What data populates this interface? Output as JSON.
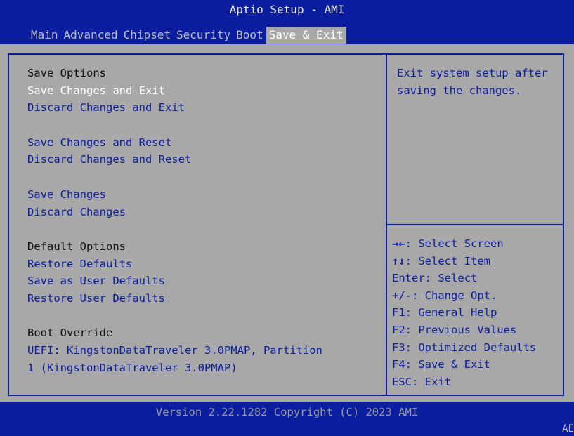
{
  "header": {
    "title": "Aptio Setup - AMI",
    "tabs": [
      "Main",
      "Advanced",
      "Chipset",
      "Security",
      "Boot",
      "Save & Exit"
    ],
    "active_tab": "Save & Exit"
  },
  "menu": {
    "save_options_header": "Save Options",
    "save_changes_and_exit": "Save Changes and Exit",
    "discard_changes_and_exit": "Discard Changes and Exit",
    "save_changes_and_reset": "Save Changes and Reset",
    "discard_changes_and_reset": "Discard Changes and Reset",
    "save_changes": "Save Changes",
    "discard_changes": "Discard Changes",
    "default_options_header": "Default Options",
    "restore_defaults": "Restore Defaults",
    "save_as_user_defaults": "Save as User Defaults",
    "restore_user_defaults": "Restore User Defaults",
    "boot_override_header": "Boot Override",
    "boot_override_line1": "UEFI: KingstonDataTraveler 3.0PMAP, Partition",
    "boot_override_line2": "1 (KingstonDataTraveler 3.0PMAP)"
  },
  "help": {
    "text": "Exit system setup after saving the changes."
  },
  "keys": [
    {
      "glyph": "→←",
      "text": ": Select Screen",
      "icon": "left-right-arrows-icon"
    },
    {
      "glyph": "↑↓",
      "text": ": Select Item",
      "icon": "up-down-arrows-icon"
    },
    {
      "glyph": "",
      "text": "Enter: Select"
    },
    {
      "glyph": "",
      "text": "+/-: Change Opt."
    },
    {
      "glyph": "",
      "text": "F1: General Help"
    },
    {
      "glyph": "",
      "text": "F2: Previous Values"
    },
    {
      "glyph": "",
      "text": "F3: Optimized Defaults"
    },
    {
      "glyph": "",
      "text": "F4: Save & Exit"
    },
    {
      "glyph": "",
      "text": "ESC: Exit"
    }
  ],
  "footer": {
    "version": "Version 2.22.1282 Copyright (C) 2023 AMI",
    "corner": "AE"
  },
  "colors": {
    "bios_blue": "#0c1ea0",
    "background_gray": "#a8a8a8",
    "selected_white": "#ffffff"
  }
}
